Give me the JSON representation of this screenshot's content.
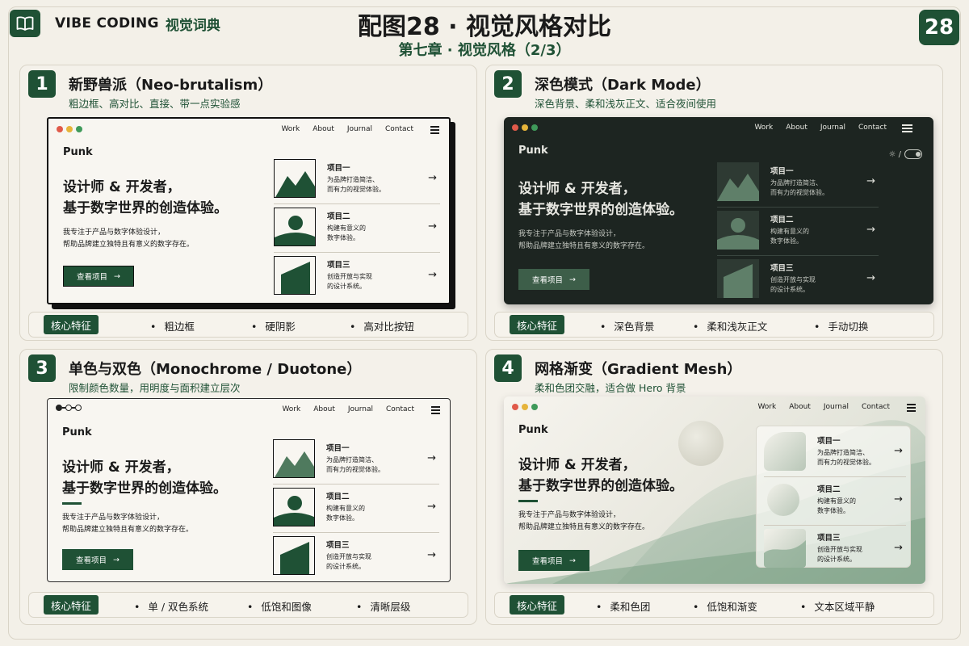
{
  "header": {
    "brand": "VIBE CODING",
    "brand_sub": "视觉词典",
    "title": "配图28 · 视觉风格对比",
    "subtitle": "第七章 · 视觉风格（2/3）",
    "page_number": "28"
  },
  "mockup": {
    "nav": [
      "Work",
      "About",
      "Journal",
      "Contact"
    ],
    "logo": "Punk",
    "hero_line1": "设计师 & 开发者，",
    "hero_line2": "基于数字世界的创造体验。",
    "body_line1": "我专注于产品与数字体验设计，",
    "body_line2": "帮助品牌建立独特且有意义的数字存在。",
    "cta": "查看项目",
    "cta_arrow": "→",
    "arrow": "→",
    "toggle": "☼ /",
    "projects": [
      {
        "title": "项目一",
        "line1": "为品牌打造简洁、",
        "line2": "而有力的视觉体验。"
      },
      {
        "title": "项目二",
        "line1": "构建有意义的",
        "line2": "数字体验。"
      },
      {
        "title": "项目三",
        "line1": "创造开放与实现",
        "line2": "的设计系统。"
      }
    ]
  },
  "feature_label": "核心特征",
  "panels": [
    {
      "num": "1",
      "title": "新野兽派（Neo-brutalism）",
      "desc": "粗边框、高对比、直接、带一点实验感",
      "features": [
        "粗边框",
        "硬阴影",
        "高对比按钮"
      ]
    },
    {
      "num": "2",
      "title": "深色模式（Dark Mode）",
      "desc": "深色背景、柔和浅灰正文、适合夜间使用",
      "features": [
        "深色背景",
        "柔和浅灰正文",
        "手动切换"
      ]
    },
    {
      "num": "3",
      "title": "单色与双色（Monochrome / Duotone）",
      "desc": "限制颜色数量，用明度与面积建立层次",
      "features": [
        "单 / 双色系统",
        "低饱和图像",
        "清晰层级"
      ]
    },
    {
      "num": "4",
      "title": "网格渐变（Gradient Mesh）",
      "desc": "柔和色团交融，适合做 Hero 背景",
      "features": [
        "柔和色团",
        "低饱和渐变",
        "文本区域平静"
      ]
    }
  ],
  "colors": {
    "accent": "#1f5135",
    "background": "#f3f0e8",
    "dark_bg": "#1d2521"
  },
  "icons": [
    "book-icon",
    "arrow-right-icon",
    "menu-icon",
    "sun-icon",
    "toggle-switch-icon",
    "mountain-icon",
    "sun-hill-icon",
    "slope-icon"
  ]
}
